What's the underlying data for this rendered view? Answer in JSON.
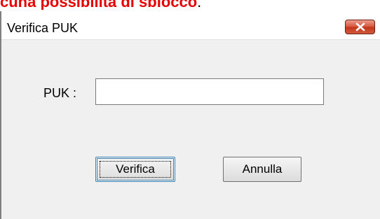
{
  "page_heading": {
    "text": "cuna possibilità di sblocco",
    "tail": "."
  },
  "dialog": {
    "title": "Verifica PUK",
    "close_icon": "close-icon",
    "close_color": "#c1351a",
    "puk_label": "PUK :",
    "puk_value": "",
    "buttons": {
      "verify": "Verifica",
      "cancel": "Annulla"
    }
  }
}
